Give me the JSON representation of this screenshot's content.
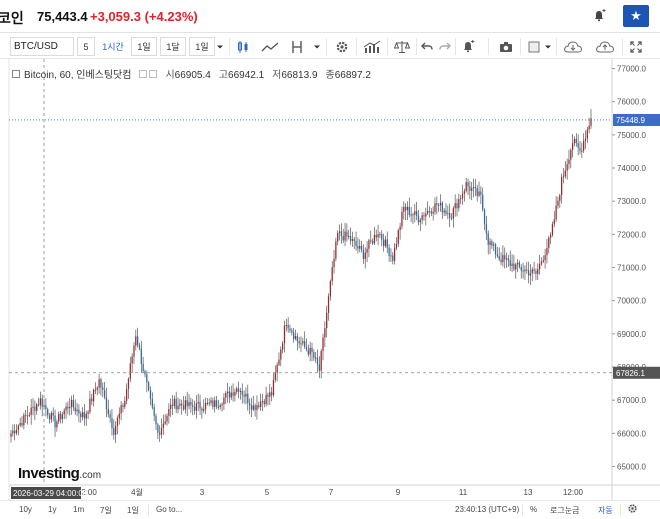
{
  "header": {
    "title": "코인",
    "price": "75,443.4",
    "change": "+3,059.3",
    "change_pct": "(+4.23%)",
    "colors": {
      "negative": "#e0222b",
      "star_bg": "#1c55b4"
    },
    "icons": [
      "bell-plus-icon",
      "star-icon"
    ]
  },
  "toolbar": {
    "symbol": "BTC/USD",
    "interval_value": "5",
    "intervals": [
      "1시간",
      "1일",
      "1달",
      "1일"
    ],
    "active_interval": "1시간",
    "icons": [
      "candlestick-icon",
      "line-chart-icon",
      "compare-icon",
      "settings-icon",
      "indicators-icon",
      "scale-icon",
      "undo-icon",
      "redo-icon",
      "alert-icon",
      "camera-icon",
      "color-square-icon",
      "cloud-download-icon",
      "cloud-upload-icon",
      "fullscreen-icon"
    ]
  },
  "legend": {
    "name": "Bitcoin, 60, 인베스팅닷컴",
    "open_label": "시",
    "open": "66905.4",
    "high_label": "고",
    "high": "66942.1",
    "low_label": "저",
    "low": "66813.9",
    "close_label": "종",
    "close": "66897.2"
  },
  "chart_data": {
    "type": "candlestick",
    "title": "Bitcoin, 60, 인베스팅닷컴",
    "ylim": [
      64500,
      77400
    ],
    "y_ticks": [
      "65000.0",
      "66000.0",
      "67000.0",
      "68000.0",
      "69000.0",
      "70000.0",
      "71000.0",
      "72000.0",
      "73000.0",
      "74000.0",
      "75000.0",
      "76000.0",
      "77000.0"
    ],
    "x_ticks": [
      "2:00",
      "4월",
      "3",
      "5",
      "7",
      "9",
      "11",
      "13",
      "12:00"
    ],
    "crosshair_date": "2026-03-29 04:00:00",
    "crosshair_price": "67826.1",
    "last_price": "75448.9",
    "colors": {
      "up": "#9b2a2a",
      "down": "#2c6b9e",
      "wick": "#555555",
      "last_line": "#3d6cc7"
    },
    "segments": [
      [
        0,
        66000
      ],
      [
        8,
        66500
      ],
      [
        16,
        67000
      ],
      [
        24,
        66300
      ],
      [
        32,
        66900
      ],
      [
        40,
        66500
      ],
      [
        48,
        67600
      ],
      [
        56,
        66100
      ],
      [
        62,
        67000
      ],
      [
        68,
        69000
      ],
      [
        76,
        66900
      ],
      [
        80,
        66000
      ],
      [
        88,
        66900
      ],
      [
        100,
        66800
      ],
      [
        112,
        66900
      ],
      [
        124,
        67400
      ],
      [
        132,
        66800
      ],
      [
        142,
        67200
      ],
      [
        150,
        69400
      ],
      [
        156,
        68800
      ],
      [
        164,
        68400
      ],
      [
        168,
        67900
      ],
      [
        174,
        70500
      ],
      [
        178,
        72000
      ],
      [
        184,
        71900
      ],
      [
        192,
        71400
      ],
      [
        200,
        72100
      ],
      [
        208,
        71300
      ],
      [
        214,
        72800
      ],
      [
        222,
        72500
      ],
      [
        232,
        72900
      ],
      [
        240,
        72600
      ],
      [
        248,
        73500
      ],
      [
        256,
        73100
      ],
      [
        260,
        71800
      ],
      [
        266,
        71300
      ],
      [
        276,
        71000
      ],
      [
        286,
        70800
      ],
      [
        294,
        71900
      ],
      [
        300,
        73600
      ],
      [
        306,
        74800
      ],
      [
        310,
        74500
      ],
      [
        316,
        75500
      ]
    ]
  },
  "logo": {
    "brand": "Investing",
    "suffix": ".com"
  },
  "bottom_bar": {
    "ranges": [
      "10y",
      "1y",
      "1m",
      "7일",
      "1일",
      "Go to..."
    ],
    "time": "23:40:13 (UTC+9)",
    "percent": "%",
    "log": "로그눈금",
    "auto": "자동"
  }
}
